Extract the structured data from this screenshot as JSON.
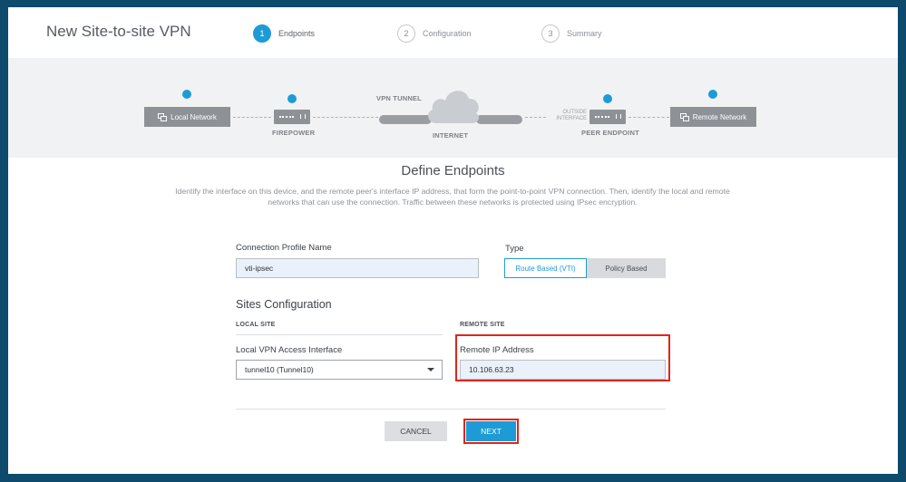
{
  "header": {
    "title": "New Site-to-site VPN",
    "steps": [
      {
        "num": "1",
        "label": "Endpoints"
      },
      {
        "num": "2",
        "label": "Configuration"
      },
      {
        "num": "3",
        "label": "Summary"
      }
    ]
  },
  "diagram": {
    "local_network": "Local Network",
    "firepower": "FIREPOWER",
    "vpn_tunnel": "VPN TUNNEL",
    "internet": "INTERNET",
    "outside_interface": "OUTSIDE\nINTERFACE",
    "peer_endpoint": "PEER ENDPOINT",
    "remote_network": "Remote Network"
  },
  "section": {
    "title": "Define Endpoints",
    "description": "Identify the interface on this device, and the remote peer's interface IP address, that form the point-to-point VPN connection. Then, identify the local and remote networks that can use the connection. Traffic between these networks is protected using IPsec encryption."
  },
  "form": {
    "connection_profile_label": "Connection Profile Name",
    "connection_profile_value": "vti-ipsec",
    "type_label": "Type",
    "type_options": [
      "Route Based (VTI)",
      "Policy Based"
    ],
    "sites_heading": "Sites Configuration",
    "local_site": "LOCAL SITE",
    "remote_site": "REMOTE SITE",
    "local_vpn_label": "Local VPN Access Interface",
    "local_vpn_value": "tunnel10 (Tunnel10)",
    "remote_ip_label": "Remote IP Address",
    "remote_ip_value": "10.106.63.23"
  },
  "buttons": {
    "cancel": "CANCEL",
    "next": "NEXT"
  },
  "colors": {
    "accent": "#1e9bd7",
    "highlight": "#e0251b",
    "border": "#0e4a6b"
  }
}
